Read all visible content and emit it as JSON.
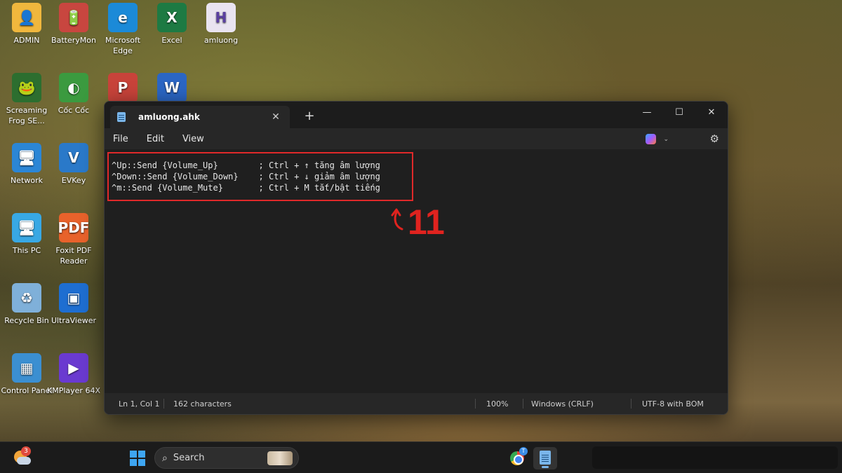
{
  "desktop": {
    "icons": [
      {
        "label": "ADMIN",
        "icon": "user-folder-icon",
        "color": "#f0b73d",
        "glyph": "👤"
      },
      {
        "label": "BatteryMon",
        "icon": "battery-monitor-icon",
        "color": "#c8463f",
        "glyph": "🔋"
      },
      {
        "label": "Microsoft Edge",
        "icon": "edge-icon",
        "color": "#1b8ad8",
        "glyph": "e"
      },
      {
        "label": "Excel",
        "icon": "excel-icon",
        "color": "#1d7a43",
        "glyph": "X"
      },
      {
        "label": "amluong",
        "icon": "ahk-file-icon",
        "color": "#e9e4f0",
        "glyph": "H"
      },
      {
        "label": "Screaming Frog SE...",
        "icon": "screaming-frog-icon",
        "color": "#2c6e2f",
        "glyph": "🐸"
      },
      {
        "label": "Cốc Cốc",
        "icon": "coc-coc-icon",
        "color": "#3b9a3f",
        "glyph": "◐"
      },
      {
        "label": "",
        "icon": "powerpoint-icon",
        "color": "#c8433a",
        "glyph": "P"
      },
      {
        "label": "",
        "icon": "word-icon",
        "color": "#2b66c4",
        "glyph": "W"
      },
      {
        "label": "Network",
        "icon": "network-icon",
        "color": "#2b86d6",
        "glyph": "🖥"
      },
      {
        "label": "EVKey",
        "icon": "evkey-icon",
        "color": "#2a79c9",
        "glyph": "V"
      },
      {
        "label": "This PC",
        "icon": "this-pc-icon",
        "color": "#38a8e4",
        "glyph": "🖥"
      },
      {
        "label": "Foxit PDF Reader",
        "icon": "foxit-pdf-icon",
        "color": "#e8622b",
        "glyph": "PDF"
      },
      {
        "label": "Recycle Bin",
        "icon": "recycle-bin-icon",
        "color": "#7fb0d9",
        "glyph": "♻"
      },
      {
        "label": "UltraViewer",
        "icon": "ultraviewer-icon",
        "color": "#1e6ed1",
        "glyph": "▣"
      },
      {
        "label": "Control Panel",
        "icon": "control-panel-icon",
        "color": "#3b8fd1",
        "glyph": "▦"
      },
      {
        "label": "KMPlayer 64X",
        "icon": "kmplayer-icon",
        "color": "#6a3ad0",
        "glyph": "▶"
      }
    ]
  },
  "window": {
    "tab_title": "amluong.ahk",
    "tab_close": "✕",
    "new_tab": "+",
    "minimize": "—",
    "maximize": "☐",
    "close": "✕",
    "menus": [
      "File",
      "Edit",
      "View"
    ],
    "copilot_chevron": "⌄",
    "settings_glyph": "⚙",
    "code_lines": [
      "^Up::Send {Volume_Up}        ; Ctrl + ↑ tăng âm lượng",
      "^Down::Send {Volume_Down}    ; Ctrl + ↓ giảm âm lượng",
      "^m::Send {Volume_Mute}       ; Ctrl + M tắt/bật tiếng"
    ],
    "annotation_number": "11",
    "status": {
      "position": "Ln 1, Col 1",
      "characters": "162 characters",
      "zoom": "100%",
      "line_ending": "Windows (CRLF)",
      "encoding": "UTF-8 with BOM"
    }
  },
  "taskbar": {
    "weather_badge": "3",
    "search_label": "Search",
    "search_glyph": "⌕",
    "chrome_badge": "T"
  },
  "colors": {
    "accent_red": "#e0292a",
    "notepad_blue": "#7ab6ea",
    "windows_blue": "#3ea6f2"
  }
}
